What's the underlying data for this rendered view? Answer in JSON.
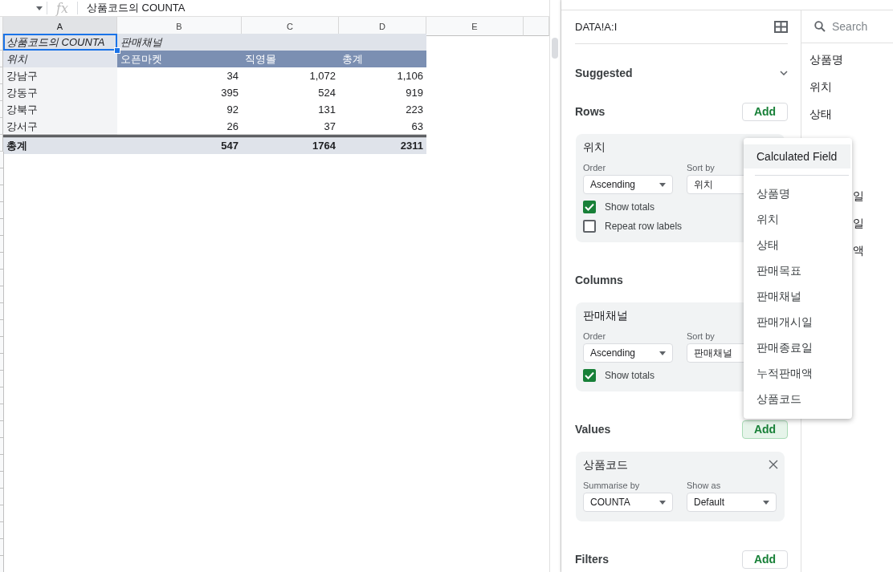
{
  "formula_bar": {
    "fx_label": "fx",
    "formula": "상품코드의 COUNTA"
  },
  "sheet": {
    "columns": [
      {
        "label": "A",
        "selected": true
      },
      {
        "label": "B",
        "selected": false
      },
      {
        "label": "C",
        "selected": false
      },
      {
        "label": "D",
        "selected": false
      },
      {
        "label": "E",
        "selected": false
      }
    ],
    "pivot": {
      "title_row": [
        {
          "text": "상품코드의 COUNTA",
          "selected": true
        },
        {
          "text": "판매채널",
          "selected": false
        }
      ],
      "header_row": [
        "위치",
        "오픈마켓",
        "직영몰",
        "총계"
      ],
      "rows": [
        [
          "강남구",
          "34",
          "1,072",
          "1,106"
        ],
        [
          "강동구",
          "395",
          "524",
          "919"
        ],
        [
          "강북구",
          "92",
          "131",
          "223"
        ],
        [
          "강서구",
          "26",
          "37",
          "63"
        ]
      ],
      "total_row": [
        "총계",
        "547",
        "1764",
        "2311"
      ]
    }
  },
  "pivot_editor": {
    "range": "DATA!A:I",
    "sections": [
      {
        "title": "Suggested",
        "kind": "collapsible",
        "expanded": false
      },
      {
        "title": "Rows",
        "kind": "group",
        "add_button": {
          "label": "Add",
          "active": false
        },
        "card": {
          "field": "위치",
          "removable": false,
          "selects": [
            {
              "label": "Order",
              "value": "Ascending"
            },
            {
              "label": "Sort by",
              "value": "위치"
            }
          ],
          "options": [
            {
              "label": "Show totals",
              "checked": true
            },
            {
              "label": "Repeat row labels",
              "checked": false
            }
          ]
        }
      },
      {
        "title": "Columns",
        "kind": "group",
        "card": {
          "field": "판매채널",
          "removable": false,
          "selects": [
            {
              "label": "Order",
              "value": "Ascending"
            },
            {
              "label": "Sort by",
              "value": "판매채널"
            }
          ],
          "options": [
            {
              "label": "Show totals",
              "checked": true
            }
          ]
        }
      },
      {
        "title": "Values",
        "kind": "group",
        "add_button": {
          "label": "Add",
          "active": true
        },
        "card": {
          "field": "상품코드",
          "removable": true,
          "selects": [
            {
              "label": "Summarise by",
              "value": "COUNTA"
            },
            {
              "label": "Show as",
              "value": "Default"
            }
          ]
        }
      },
      {
        "title": "Filters",
        "kind": "group",
        "add_button": {
          "label": "Add",
          "active": false
        }
      }
    ]
  },
  "field_list": {
    "search": {
      "placeholder": "Search"
    },
    "items": [
      "상품명",
      "위치",
      "상태"
    ],
    "partial_items": [
      "일",
      "일",
      "액"
    ]
  },
  "add_menu": {
    "items": [
      {
        "label": "Calculated Field",
        "kind": "action",
        "highlighted": true
      },
      {
        "label": "상품명",
        "kind": "field",
        "highlighted": false
      },
      {
        "label": "위치",
        "kind": "field",
        "highlighted": false
      },
      {
        "label": "상태",
        "kind": "field",
        "highlighted": false
      },
      {
        "label": "판매목표",
        "kind": "field",
        "highlighted": false
      },
      {
        "label": "판매채널",
        "kind": "field",
        "highlighted": false
      },
      {
        "label": "판매개시일",
        "kind": "field",
        "highlighted": false
      },
      {
        "label": "판매종료일",
        "kind": "field",
        "highlighted": false
      },
      {
        "label": "누적판매액",
        "kind": "field",
        "highlighted": false
      },
      {
        "label": "상품코드",
        "kind": "field",
        "highlighted": false
      }
    ]
  }
}
